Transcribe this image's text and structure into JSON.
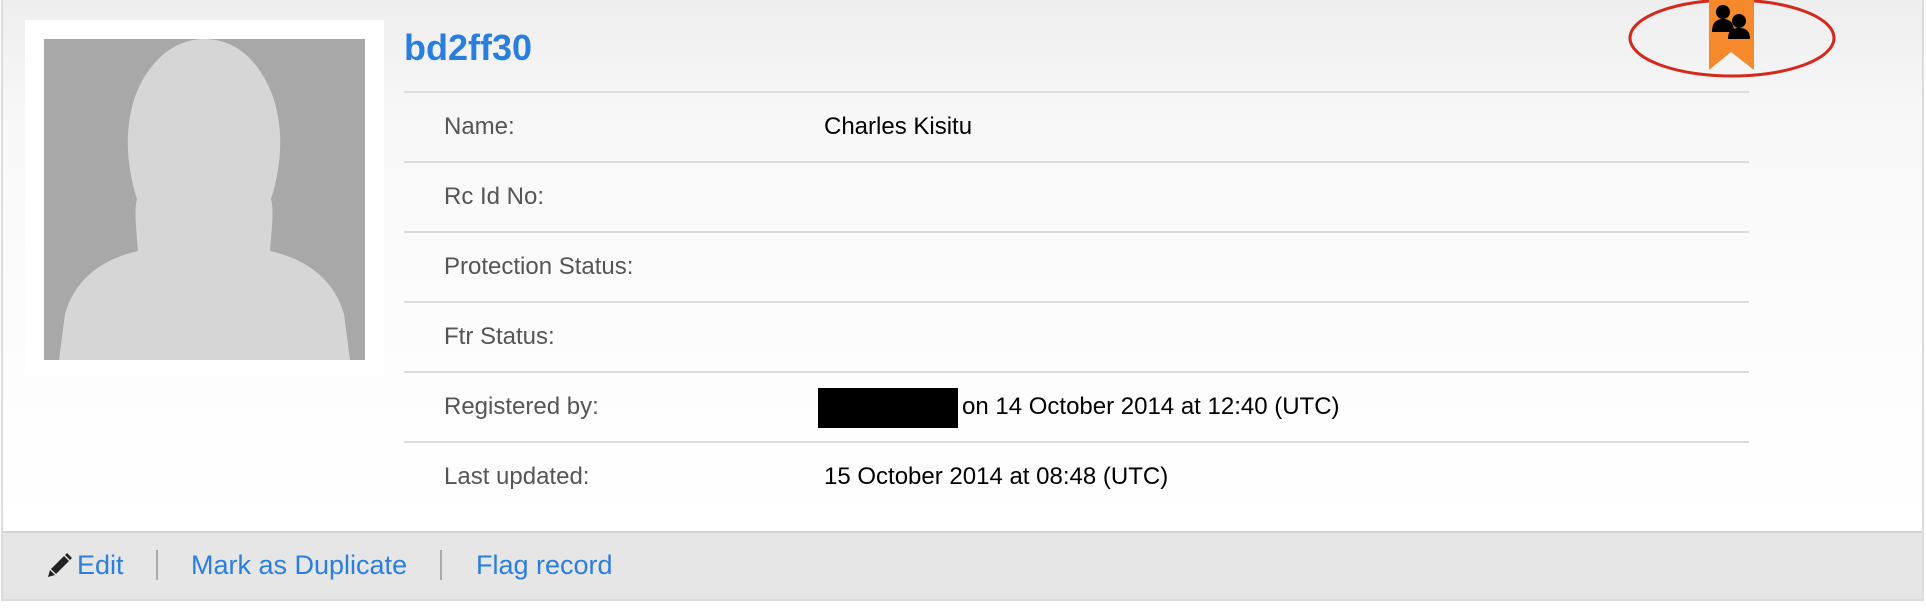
{
  "record": {
    "id": "bd2ff30"
  },
  "fields": [
    {
      "label": "Name:",
      "value": "Charles Kisitu"
    },
    {
      "label": "Rc Id No:",
      "value": ""
    },
    {
      "label": "Protection Status:",
      "value": ""
    },
    {
      "label": "Ftr Status:",
      "value": ""
    },
    {
      "label": "Registered by:",
      "value": "on 14 October 2014 at 12:40 (UTC)"
    },
    {
      "label": "Last updated:",
      "value": "15 October 2014 at 08:48 (UTC)"
    }
  ],
  "footer": {
    "edit_label": "Edit",
    "duplicate_label": "Mark as Duplicate",
    "flag_label": "Flag record"
  },
  "icons": {
    "photo": "profile-silhouette-icon",
    "badge": "family-group-bookmark-icon",
    "edit": "pencil-icon"
  },
  "colors": {
    "link": "#2a7ee0",
    "badge": "#f5892b",
    "annotation": "#d42a1e",
    "redaction": "#000000"
  }
}
